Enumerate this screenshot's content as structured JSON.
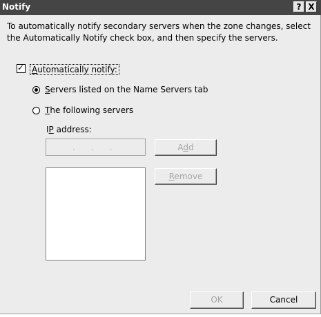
{
  "window": {
    "title": "Notify",
    "help_button": "?",
    "close_button": "X"
  },
  "description": {
    "line1": "To automatically notify secondary servers when the zone changes, select",
    "line2": "the Automatically Notify check box, and then specify the servers."
  },
  "auto_notify": {
    "checked": true,
    "label_mnemonic": "A",
    "label_rest": "utomatically notify:"
  },
  "radios": {
    "name_servers": {
      "selected": true,
      "label_mnemonic": "S",
      "label_rest": "ervers listed on the Name Servers tab"
    },
    "following": {
      "selected": false,
      "label_mnemonic": "T",
      "label_rest": "he following servers"
    }
  },
  "ip_address": {
    "label_pre": "I",
    "label_mnemonic": "P",
    "label_rest": " address:",
    "placeholder": ". . ."
  },
  "buttons": {
    "add_pre": "A",
    "add_mnemonic": "d",
    "add_rest": "d",
    "remove_mnemonic": "R",
    "remove_rest": "emove",
    "ok": "OK",
    "cancel": "Cancel"
  }
}
